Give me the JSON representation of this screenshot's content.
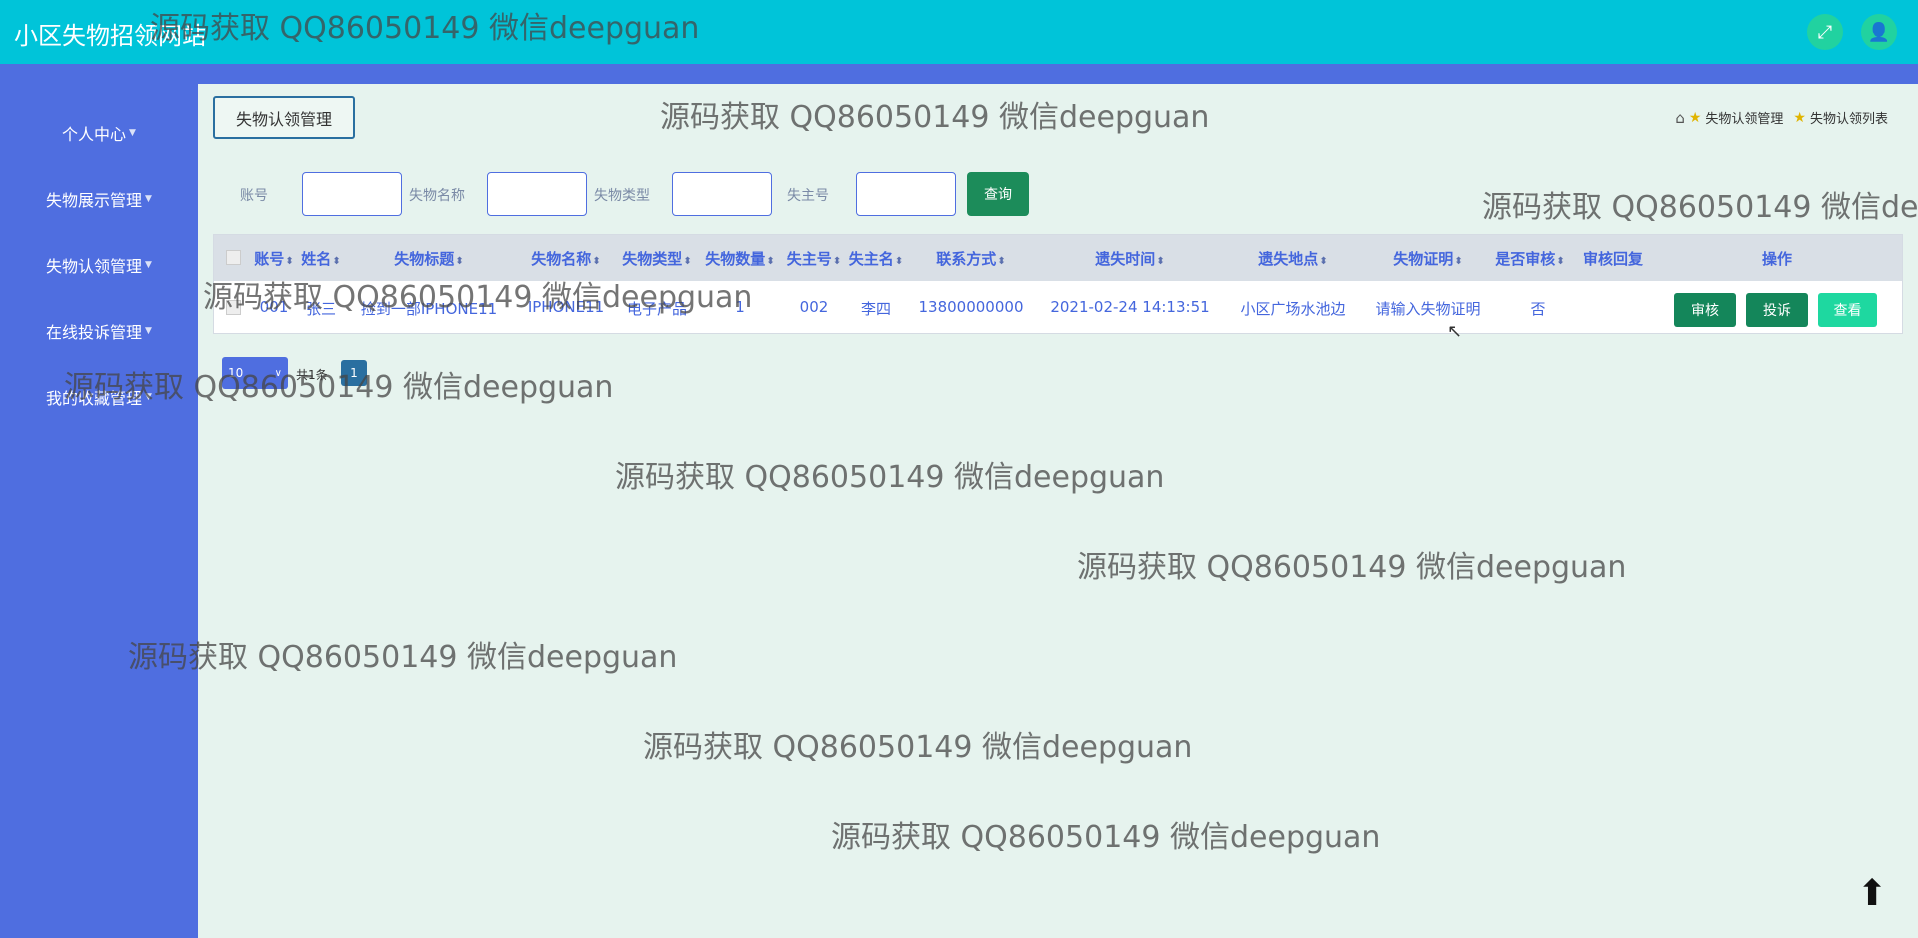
{
  "app": {
    "title": "小区失物招领网站"
  },
  "topbar_icons": [
    "fullscreen-icon",
    "user-icon"
  ],
  "sidebar": {
    "items": [
      {
        "label": "个人中心"
      },
      {
        "label": "失物展示管理"
      },
      {
        "label": "失物认领管理"
      },
      {
        "label": "在线投诉管理"
      },
      {
        "label": "我的收藏管理"
      }
    ]
  },
  "header": {
    "section_button": "失物认领管理",
    "breadcrumb": [
      "失物认领管理",
      "失物认领列表"
    ]
  },
  "search": {
    "fields": [
      {
        "label": "账号"
      },
      {
        "label": "失物名称"
      },
      {
        "label": "失物类型"
      },
      {
        "label": "失主号"
      }
    ],
    "query_button": "查询"
  },
  "table": {
    "headers": [
      "账号",
      "姓名",
      "失物标题",
      "失物名称",
      "失物类型",
      "失物数量",
      "失主号",
      "失主名",
      "联系方式",
      "遗失时间",
      "遗失地点",
      "失物证明",
      "是否审核",
      "审核回复",
      "操作"
    ],
    "rows": [
      {
        "cells": [
          "001",
          "张三",
          "捡到一部IPHONE11",
          "IPHONE11",
          "电子产品",
          "1",
          "002",
          "李四",
          "13800000000",
          "2021-02-24 14:13:51",
          "小区广场水池边",
          "请输入失物证明",
          "否",
          ""
        ]
      }
    ],
    "actions": [
      "审核",
      "投诉",
      "查看"
    ]
  },
  "pagination": {
    "page_size": "10",
    "total_text": "共1条",
    "current_page": "1"
  },
  "watermark_text": "源码获取 QQ86050149 微信deepguan",
  "colors": {
    "topbar": "#00c4d9",
    "sidebar": "#4f6ee0",
    "content_bg": "#e6f3ee",
    "accent_green": "#1c8c5a",
    "view_button": "#1ed8a0"
  }
}
